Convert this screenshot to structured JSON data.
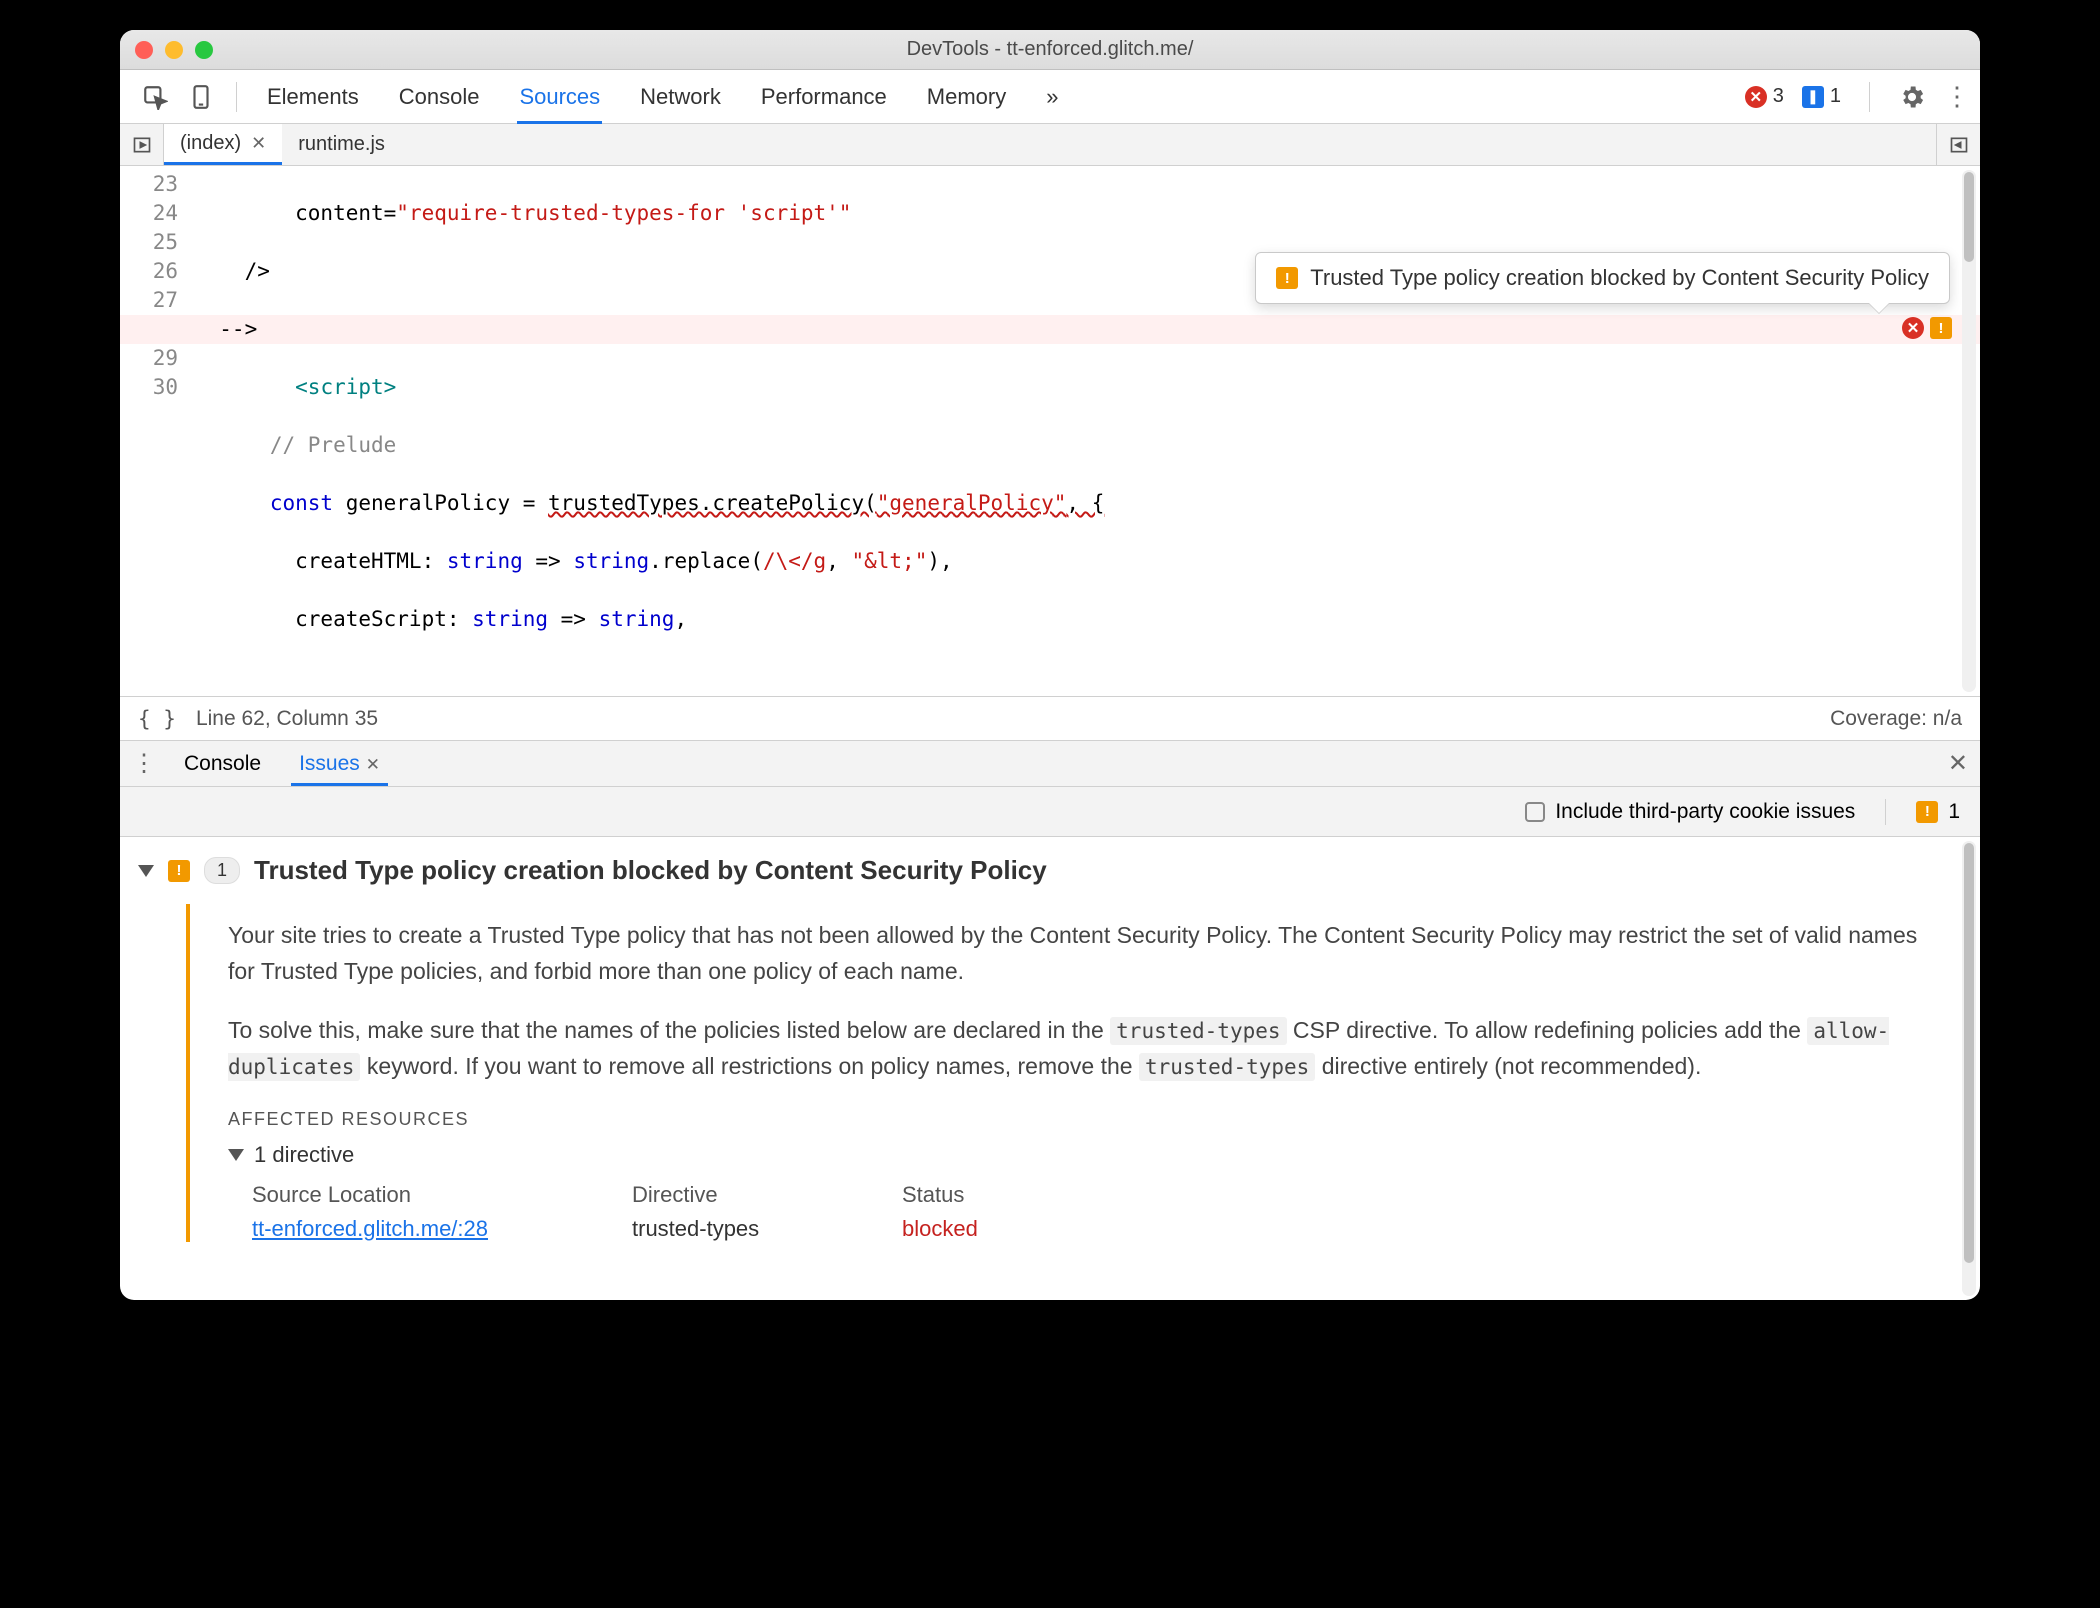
{
  "window": {
    "title": "DevTools - tt-enforced.glitch.me/"
  },
  "toolbar": {
    "tabs": [
      "Elements",
      "Console",
      "Sources",
      "Network",
      "Performance",
      "Memory"
    ],
    "activeTab": "Sources",
    "overflowGlyph": "»",
    "errorCount": "3",
    "messageCount": "1"
  },
  "fileTabs": {
    "items": [
      {
        "name": "(index)",
        "active": true,
        "closable": true
      },
      {
        "name": "runtime.js",
        "active": false,
        "closable": false
      }
    ]
  },
  "code": {
    "startLine": 23,
    "lines": [
      "        content=\"require-trusted-types-for 'script'\"",
      "    />",
      "  -->",
      "        <script>",
      "      // Prelude",
      "      const generalPolicy = trustedTypes.createPolicy(\"generalPolicy\", {",
      "        createHTML: string => string.replace(/\\</g, \"&lt;\"),",
      "        createScript: string => string,"
    ],
    "highlightLine": 28,
    "tooltip": "Trusted Type policy creation blocked by Content Security Policy"
  },
  "status": {
    "cursor": "Line 62, Column 35",
    "coverage": "Coverage: n/a"
  },
  "drawer": {
    "tabs": [
      {
        "label": "Console",
        "active": false,
        "closable": false
      },
      {
        "label": "Issues",
        "active": true,
        "closable": true
      }
    ]
  },
  "issuesToolbar": {
    "checkboxLabel": "Include third-party cookie issues",
    "warnCount": "1"
  },
  "issue": {
    "count": "1",
    "title": "Trusted Type policy creation blocked by Content Security Policy",
    "p1a": "Your site tries to create a Trusted Type policy that has not been allowed by the Content Security Policy. The Content Security Policy may restrict the set of valid names for Trusted Type policies, and forbid more than one policy of each name.",
    "p2a": "To solve this, make sure that the names of the policies listed below are declared in the ",
    "p2code1": "trusted-types",
    "p2b": " CSP directive. To allow redefining policies add the ",
    "p2code2": "allow-duplicates",
    "p2c": " keyword. If you want to remove all restrictions on policy names, remove the ",
    "p2code3": "trusted-types",
    "p2d": " directive entirely (not recommended).",
    "affectedHeading": "AFFECTED RESOURCES",
    "directiveSummary": "1 directive",
    "table": {
      "headers": [
        "Source Location",
        "Directive",
        "Status"
      ],
      "row": {
        "source": "tt-enforced.glitch.me/:28",
        "directive": "trusted-types",
        "status": "blocked"
      }
    }
  }
}
